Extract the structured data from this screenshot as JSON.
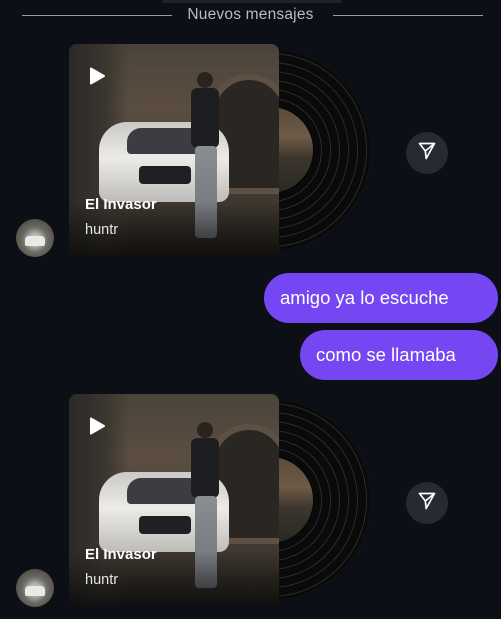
{
  "divider": {
    "label": "Nuevos mensajes"
  },
  "shares": [
    {
      "title": "El Invasor",
      "artist": "huntr"
    },
    {
      "title": "El Invasor",
      "artist": "huntr"
    }
  ],
  "messages": [
    {
      "text": "amigo ya lo escuche"
    },
    {
      "text": "como se llamaba"
    }
  ],
  "colors": {
    "background": "#0c0f16",
    "bubble": "#7447f3",
    "send_button": "#262a33"
  },
  "icons": {
    "play": "play-icon",
    "send": "send-icon",
    "vinyl": "vinyl-record"
  }
}
